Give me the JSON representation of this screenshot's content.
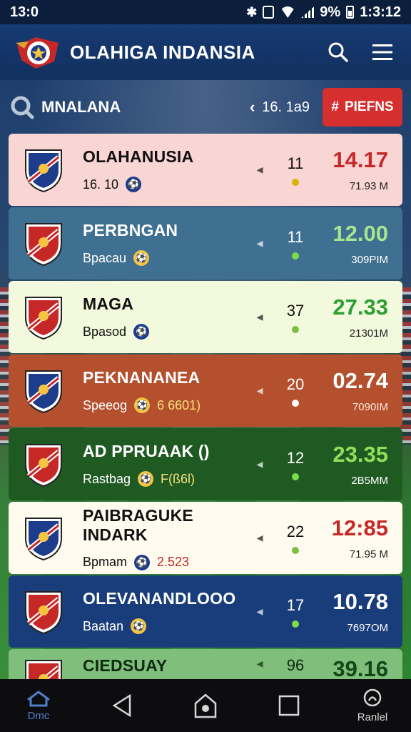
{
  "status_bar": {
    "time": "13:0",
    "battery": "9%",
    "clock": "1:3:12"
  },
  "app_bar": {
    "title": "OLAHIGA INDANSIA"
  },
  "filter_bar": {
    "label": "MNALANA",
    "page": "16. 1a9",
    "filter_button": "PIEFNS"
  },
  "rows": [
    {
      "name": "OLAHANUSIA",
      "sub": "16. 10",
      "rank": "11",
      "odds": "14.17",
      "volume": "71.93 M",
      "bg": "#f9d5d3",
      "text": "#111111",
      "odds_color": "#c62828",
      "vol_color": "#222222",
      "dot": "#d9b300",
      "crest": "#1e3c8c"
    },
    {
      "name": "PERBNGAN",
      "sub": "Bpacau",
      "rank": "11",
      "odds": "12.00",
      "volume": "309PIM",
      "bg": "#3f7091",
      "text": "#ffffff",
      "odds_color": "#a6e68c",
      "vol_color": "#ffffff",
      "dot": "#7ddc4a",
      "crest": "#c62828"
    },
    {
      "name": "MAGA",
      "sub": "Bpasod",
      "rank": "37",
      "odds": "27.33",
      "volume": "21301M",
      "bg": "#f2f9dc",
      "text": "#111111",
      "odds_color": "#2e9e34",
      "vol_color": "#222222",
      "dot": "#7bc043",
      "crest": "#c62828"
    },
    {
      "name": "PEKNANANEA",
      "sub": "Speeog",
      "sub_extra": "6 6601)",
      "rank": "20",
      "odds": "02.74",
      "volume": "7090IM",
      "bg": "#b4502e",
      "text": "#ffffff",
      "odds_color": "#ffffff",
      "vol_color": "#ffe6d8",
      "dot": "#ffffff",
      "crest": "#1e3c8c"
    },
    {
      "name": "AD PPRUAAK ()",
      "sub": "Rastbag",
      "sub_extra": "F(ß6l)",
      "rank": "12",
      "odds": "23.35",
      "volume": "2B5MM",
      "bg": "#1f5a22",
      "text": "#ffffff",
      "odds_color": "#8fdf5a",
      "vol_color": "#ffffff",
      "dot": "#7ddc4a",
      "crest": "#c62828"
    },
    {
      "name": "PAIBRAGUKE INDARK",
      "sub": "Bpmam",
      "sub_extra": "2.523",
      "rank": "22",
      "odds": "12:85",
      "volume": "71.95 M",
      "bg": "#fffcef",
      "text": "#111111",
      "odds_color": "#c62828",
      "vol_color": "#222222",
      "dot": "#7bc043",
      "crest": "#1e3c8c"
    },
    {
      "name": "OLEVANANDLOOO",
      "sub": "Baatan",
      "rank": "17",
      "odds": "10.78",
      "volume": "7697OM",
      "bg": "#183d7a",
      "text": "#ffffff",
      "odds_color": "#ffffff",
      "vol_color": "#ffffff",
      "dot": "#7ddc4a",
      "crest": "#c62828"
    },
    {
      "name": "CIEDSUAY",
      "sub": "",
      "rank": "96",
      "odds": "39.16",
      "volume": "",
      "bg": "#7fbf7b",
      "text": "#0e2a10",
      "odds_color": "#13471a",
      "vol_color": "#13471a",
      "dot": "#7ddc4a",
      "crest": "#c62828"
    }
  ],
  "bottom_nav": {
    "home_label": "Dmc",
    "profile_label": "Ranlel"
  }
}
